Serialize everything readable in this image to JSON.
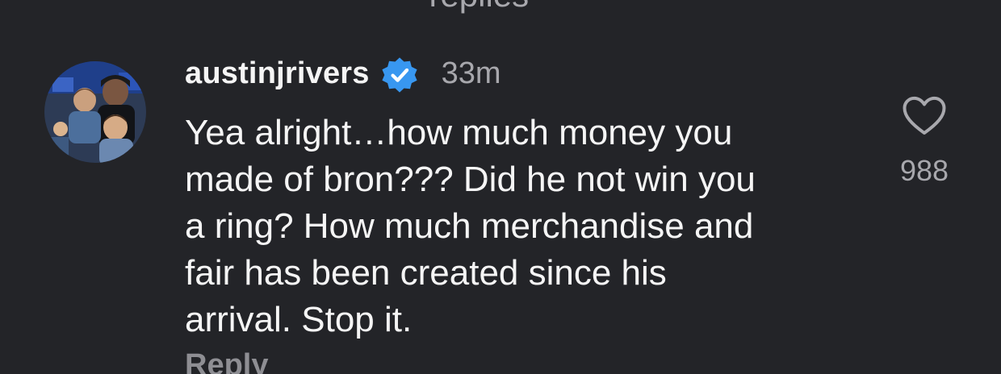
{
  "top_partial": "—— ••• replies",
  "comment": {
    "username": "austinjrivers",
    "verified": true,
    "timestamp": "33m",
    "text": "Yea alright…how much money you\nmade of bron??? Did he not win you\na ring? How much merchandise and\nfair has been created since his\narrival. Stop it.",
    "like_count": "988",
    "reply_label": "Reply"
  },
  "icons": {
    "verified": "verified-badge-icon",
    "like": "heart-outline-icon"
  },
  "colors": {
    "background": "#232428",
    "primary_text": "#f5f5f5",
    "secondary_text": "#a8a8ad",
    "verified_blue": "#3897f0"
  }
}
